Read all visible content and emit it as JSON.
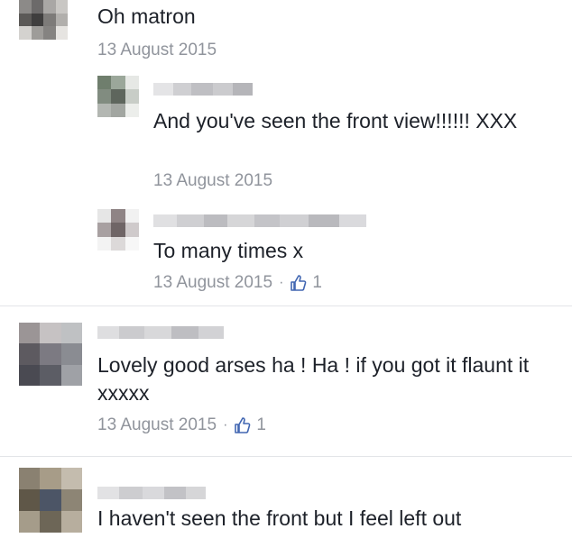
{
  "colors": {
    "text": "#1d2129",
    "meta": "#90949c",
    "like_accent": "#4267b2",
    "divider": "#e3e5e8"
  },
  "comments": [
    {
      "text": "Oh matron",
      "date": "13 August 2015",
      "replies": [
        {
          "text": "And you've seen the front view!!!!!! XXX",
          "date": "13 August 2015"
        },
        {
          "text": "To many times x",
          "date": "13 August 2015",
          "separator": "·",
          "like_icon": "thumbs-up-icon",
          "likes": "1"
        }
      ]
    },
    {
      "text": "Lovely good arses ha ! Ha ! if you got it flaunt it xxxxx",
      "date": "13 August 2015",
      "separator": "·",
      "like_icon": "thumbs-up-icon",
      "likes": "1"
    },
    {
      "text": "I haven't seen the front but I feel left out"
    }
  ]
}
